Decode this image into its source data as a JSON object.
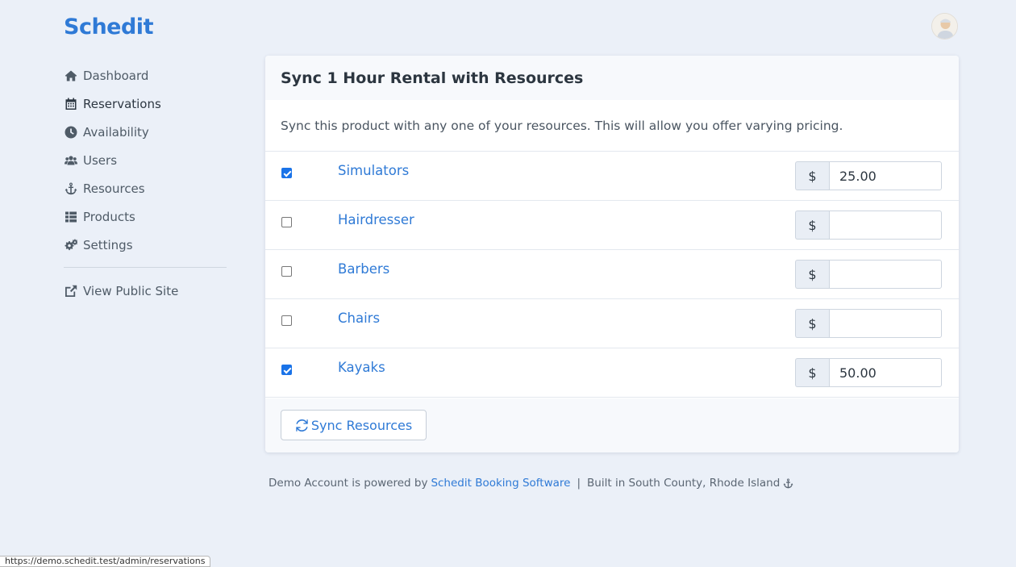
{
  "brand": "Schedit",
  "sidebar": {
    "items": [
      {
        "label": "Dashboard",
        "icon": "home-icon"
      },
      {
        "label": "Reservations",
        "icon": "calendar-icon",
        "active": true
      },
      {
        "label": "Availability",
        "icon": "clock-icon"
      },
      {
        "label": "Users",
        "icon": "users-icon"
      },
      {
        "label": "Resources",
        "icon": "anchor-icon"
      },
      {
        "label": "Products",
        "icon": "list-icon"
      },
      {
        "label": "Settings",
        "icon": "gears-icon"
      }
    ],
    "public_link": {
      "label": "View Public Site",
      "icon": "external-link-icon"
    }
  },
  "card": {
    "title": "Sync 1 Hour Rental with Resources",
    "description": "Sync this product with any one of your resources. This will allow you offer varying pricing.",
    "currency_symbol": "$",
    "resources": [
      {
        "name": "Simulators",
        "checked": true,
        "price": "25.00"
      },
      {
        "name": "Hairdresser",
        "checked": false,
        "price": ""
      },
      {
        "name": "Barbers",
        "checked": false,
        "price": ""
      },
      {
        "name": "Chairs",
        "checked": false,
        "price": ""
      },
      {
        "name": "Kayaks",
        "checked": true,
        "price": "50.00"
      }
    ],
    "sync_button_label": "Sync Resources"
  },
  "footer": {
    "prefix": "Demo Account is powered by",
    "link": "Schedit Booking Software",
    "separator": "|",
    "suffix": "Built in South County, Rhode Island"
  },
  "status_url": "https://demo.schedit.test/admin/reservations",
  "colors": {
    "accent": "#2f7ad6",
    "background": "#ebf0f8",
    "checkbox": "#1a73e8"
  }
}
